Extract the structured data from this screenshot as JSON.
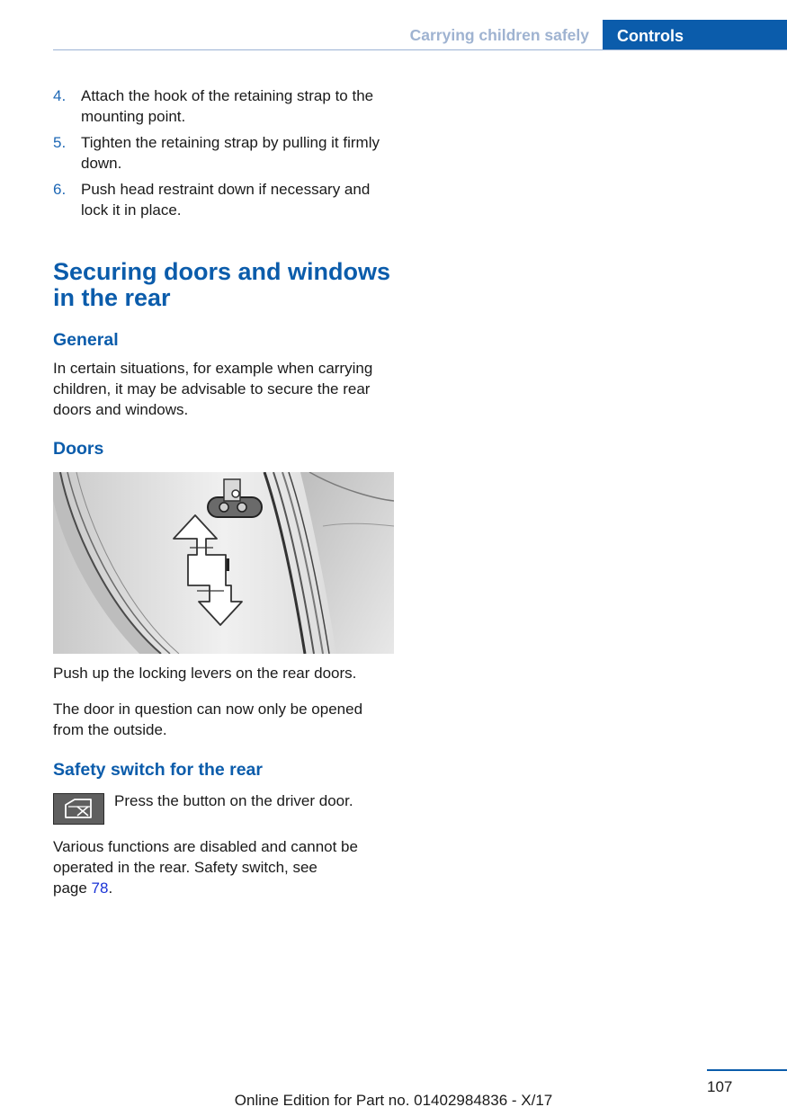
{
  "header": {
    "section": "Carrying children safely",
    "chapter": "Controls"
  },
  "steps": [
    {
      "num": "4.",
      "text": "Attach the hook of the retaining strap to the mounting point."
    },
    {
      "num": "5.",
      "text": "Tighten the retaining strap by pulling it firmly down."
    },
    {
      "num": "6.",
      "text": "Push head restraint down if necessary and lock it in place."
    }
  ],
  "section_title": "Securing doors and windows in the rear",
  "general": {
    "heading": "General",
    "text": "In certain situations, for example when carrying children, it may be advisable to secure the rear doors and windows."
  },
  "doors": {
    "heading": "Doors",
    "text1": "Push up the locking levers on the rear doors.",
    "text2": "The door in question can now only be opened from the outside."
  },
  "safety": {
    "heading": "Safety switch for the rear",
    "icon": "window-lock-switch-icon",
    "button_text": "Press the button on the driver door.",
    "text_line1": "Various functions are disabled and cannot be",
    "text_line2": "operated in the rear. Safety switch, see",
    "page_prefix": "page ",
    "page_link": "78",
    "page_suffix": "."
  },
  "footer": {
    "page_number": "107",
    "edition": "Online Edition for Part no. 01402984836 - X/17"
  },
  "colors": {
    "accent": "#0b5cab",
    "header_muted": "#9fb3d1",
    "link": "#1a33d6"
  }
}
